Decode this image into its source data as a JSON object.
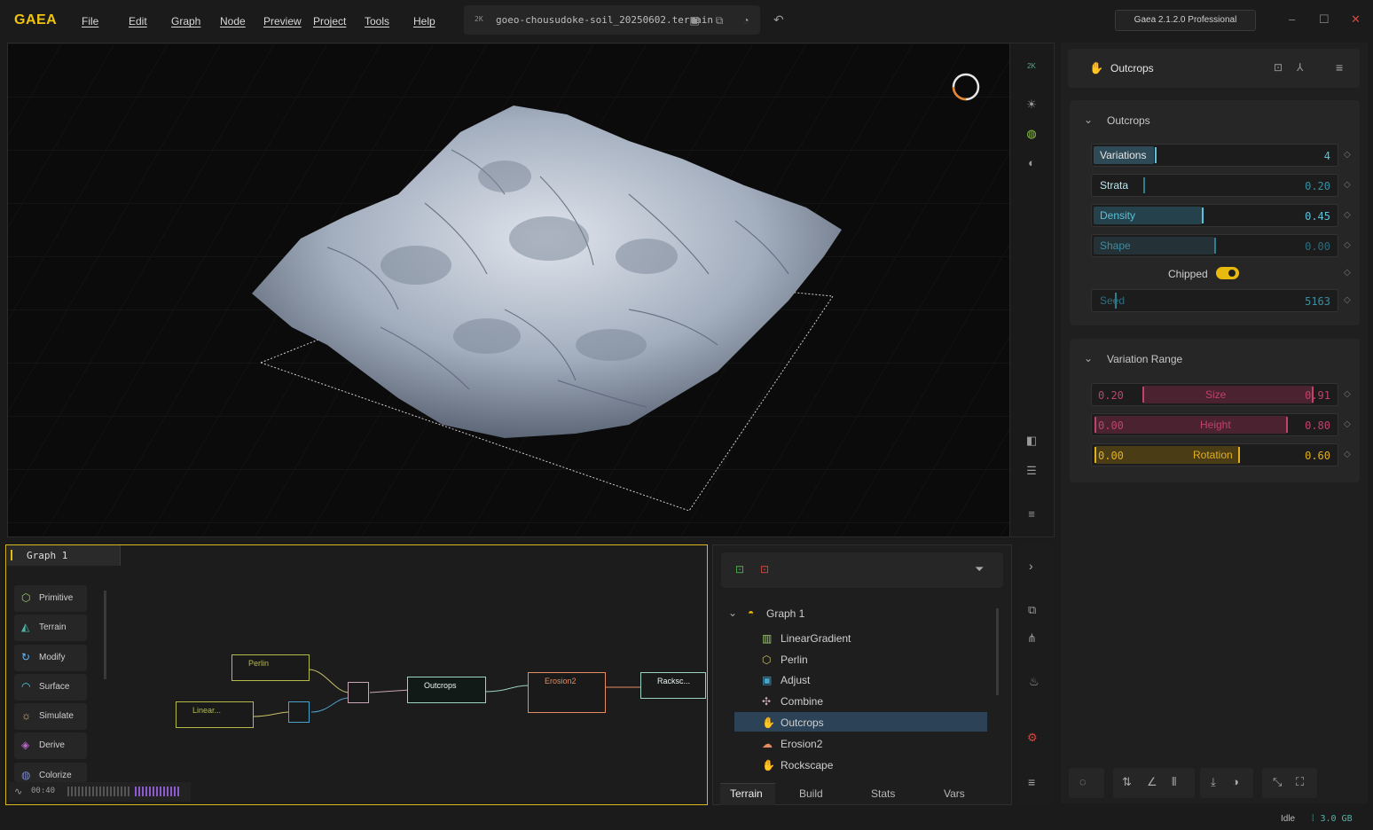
{
  "app": {
    "logo": "GAEA",
    "version": "Gaea 2.1.2.0 Professional"
  },
  "menu": [
    "File",
    "Edit",
    "Graph",
    "Node",
    "Preview",
    "Project",
    "Tools",
    "Help"
  ],
  "file": {
    "resolution": "2K",
    "name": "goeo-chousudoke-soil_20250602.terrain"
  },
  "viewport": {
    "res_badge": "2K"
  },
  "node_header": {
    "title": "Outcrops"
  },
  "outcrops_section": {
    "title": "Outcrops",
    "params": [
      {
        "label": "Variations",
        "value": "4",
        "fill": 0.25
      },
      {
        "label": "Strata",
        "value": "0.20",
        "fill": 0.2
      },
      {
        "label": "Density",
        "value": "0.45",
        "fill": 0.45
      },
      {
        "label": "Shape",
        "value": "0.00",
        "fill": 0.0
      }
    ],
    "toggle_label": "Chipped",
    "toggle_on": true,
    "seed": {
      "label": "Seed",
      "value": "5163"
    }
  },
  "variation_section": {
    "title": "Variation Range",
    "ranges": [
      {
        "label": "Size",
        "min": "0.20",
        "max": "0.91",
        "color": "#c0436a"
      },
      {
        "label": "Height",
        "min": "0.00",
        "max": "0.80",
        "color": "#c0436a"
      },
      {
        "label": "Rotation",
        "min": "0.00",
        "max": "0.60",
        "color": "#e0b020"
      }
    ]
  },
  "graph": {
    "tab": "Graph 1",
    "library": [
      "Primitive",
      "Terrain",
      "Modify",
      "Surface",
      "Simulate",
      "Derive",
      "Colorize"
    ],
    "nodes": {
      "perlin": "Perlin",
      "linear": "Linear...",
      "outcrops": "Outcrops",
      "erosion": "Erosion2",
      "rockscape": "Racksc..."
    },
    "timer": "00:40"
  },
  "tree": {
    "root": "Graph 1",
    "items": [
      "LinearGradient",
      "Perlin",
      "Adjust",
      "Combine",
      "Outcrops",
      "Erosion2",
      "Rockscape"
    ],
    "selected": "Outcrops",
    "tabs": [
      "Terrain",
      "Build",
      "Stats",
      "Vars"
    ]
  },
  "status": {
    "state": "Idle",
    "memory": "3.0 GB"
  }
}
